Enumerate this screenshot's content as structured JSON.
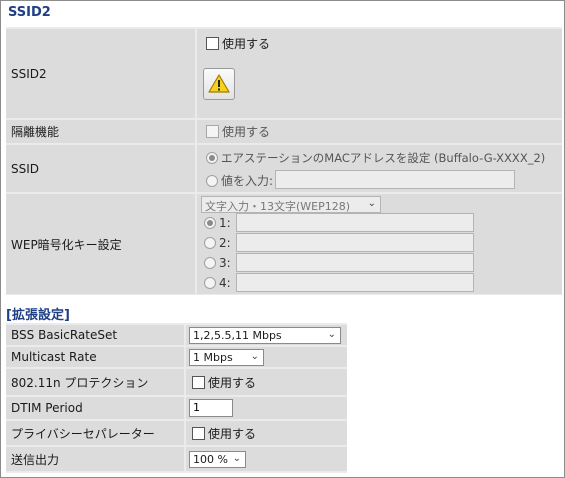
{
  "section_title": "SSID2",
  "ssid2": {
    "label": "SSID2",
    "enable_label": "使用する",
    "warning_icon": "warning-icon"
  },
  "isolation": {
    "label": "隔離機能",
    "enable_label": "使用する"
  },
  "ssid": {
    "label": "SSID",
    "option_auto": "エアステーションのMACアドレスを設定 (Buffalo-G-XXXX_2)",
    "option_manual": "値を入力:",
    "manual_value": ""
  },
  "wep": {
    "label": "WEP暗号化キー設定",
    "type_select": "文字入力・13文字(WEP128)",
    "keys": [
      {
        "label": "1:",
        "value": ""
      },
      {
        "label": "2:",
        "value": ""
      },
      {
        "label": "3:",
        "value": ""
      },
      {
        "label": "4:",
        "value": ""
      }
    ]
  },
  "extended_title": "[拡張設定]",
  "extended": {
    "bss_label": "BSS BasicRateSet",
    "bss_value": "1,2,5.5,11 Mbps",
    "multicast_label": "Multicast Rate",
    "multicast_value": "1 Mbps",
    "protection_label": "802.11n プロテクション",
    "protection_enable": "使用する",
    "dtim_label": "DTIM Period",
    "dtim_value": "1",
    "privacy_label": "プライバシーセパレーター",
    "privacy_enable": "使用する",
    "power_label": "送信出力",
    "power_value": "100 %"
  },
  "colors": {
    "title": "#1f3f86",
    "cell_bg": "#dcdcdc",
    "border": "#ebebeb"
  }
}
